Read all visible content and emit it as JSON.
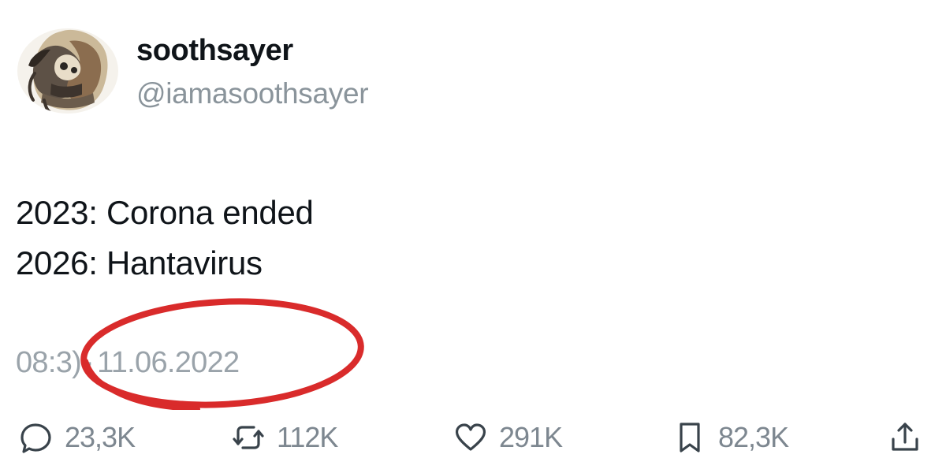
{
  "user": {
    "display_name": "soothsayer",
    "handle": "@iamasoothsayer",
    "avatar_icon": "avatar-image"
  },
  "tweet": {
    "lines": [
      "2023: Corona ended",
      "2026: Hantavirus"
    ],
    "time": "08:3",
    "time_partial": ")",
    "separator": "·",
    "date": "11.06.2022"
  },
  "annotation": {
    "shape": "red-ellipse-circle",
    "color": "#d92b2b"
  },
  "actions": {
    "reply": {
      "icon": "reply-icon",
      "count": "23,3K"
    },
    "retweet": {
      "icon": "retweet-icon",
      "count": "112K"
    },
    "like": {
      "icon": "heart-icon",
      "count": "291K"
    },
    "bookmark": {
      "icon": "bookmark-icon",
      "count": "82,3K"
    },
    "share": {
      "icon": "share-icon"
    }
  },
  "colors": {
    "text": "#0f1419",
    "secondary": "#8a949b",
    "action": "#7d8790"
  }
}
